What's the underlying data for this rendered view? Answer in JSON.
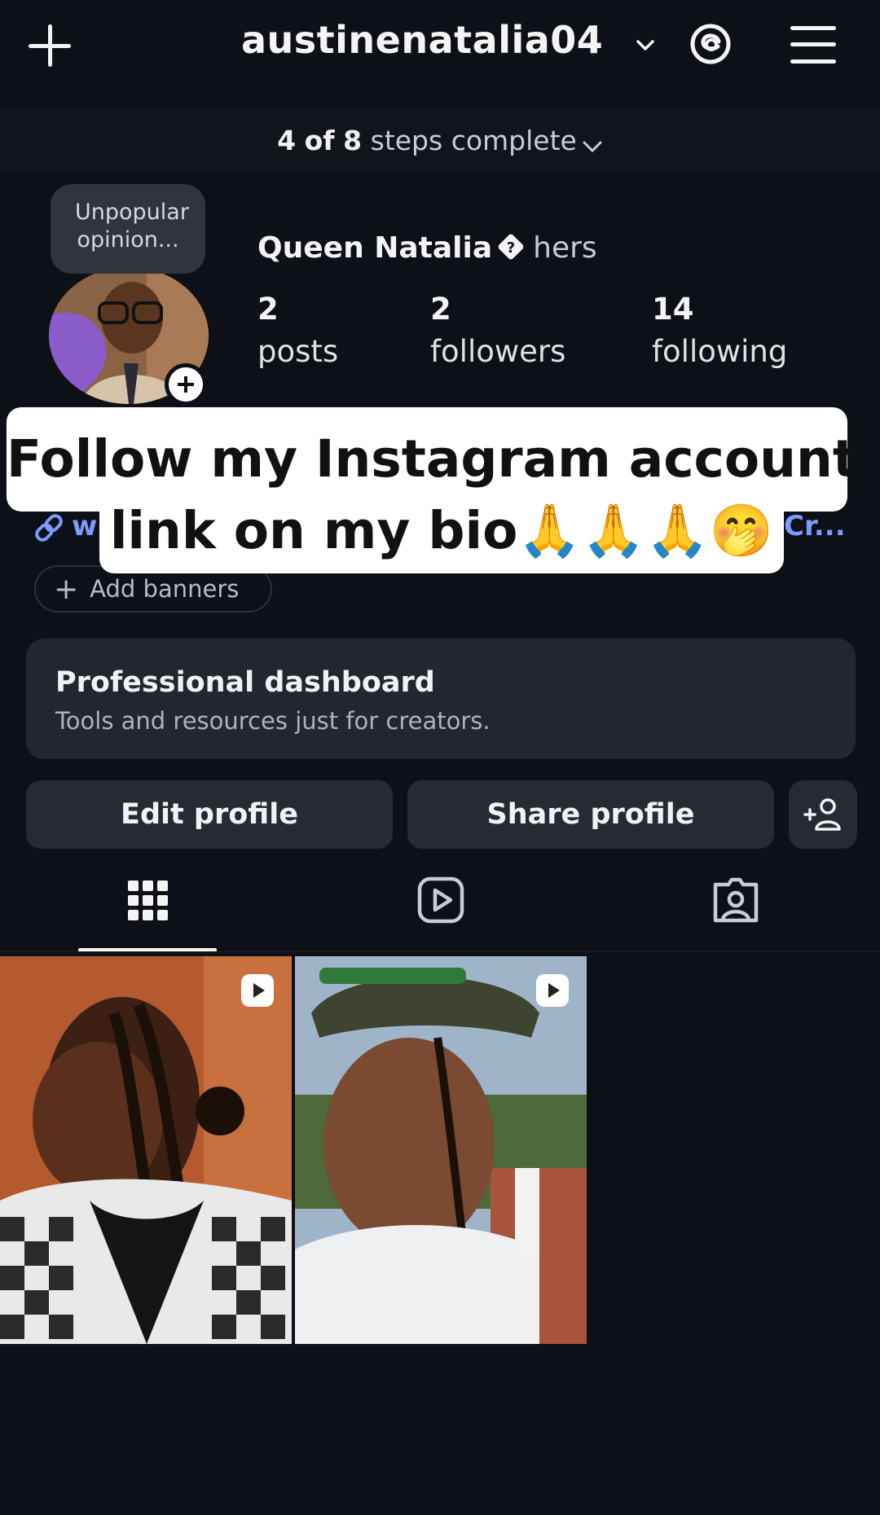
{
  "header": {
    "username": "austinenatalia04",
    "icons": [
      "plus-icon",
      "chevron-down-icon",
      "threads-icon",
      "menu-icon"
    ]
  },
  "steps": {
    "done": "4",
    "of": "of",
    "total": "8",
    "suffix": "steps complete"
  },
  "profile": {
    "note": "Unpopular opinion...",
    "display_name": "Queen Natalia",
    "pronouns": "hers",
    "stats": [
      {
        "value": "2",
        "label": "posts"
      },
      {
        "value": "2",
        "label": "followers"
      },
      {
        "value": "14",
        "label": "following"
      }
    ],
    "bio_link_partial_left": "w",
    "bio_link_partial_right": "Cr...",
    "add_banners_label": "Add banners"
  },
  "caption": {
    "line1": "Follow my Instagram account",
    "line2": "link on my bio🙏🙏🙏🤭"
  },
  "professional_dashboard": {
    "title": "Professional dashboard",
    "subtitle": "Tools and resources just for creators."
  },
  "buttons": {
    "edit_profile": "Edit profile",
    "share_profile": "Share profile"
  },
  "tabs": [
    "grid-icon",
    "reels-icon",
    "tagged-icon"
  ],
  "posts": [
    {
      "type": "reel",
      "icon": "reel-icon"
    },
    {
      "type": "reel",
      "icon": "reel-icon"
    }
  ],
  "colors": {
    "background": "#0d1016",
    "card": "#22262e",
    "link": "#7a9cff",
    "caption_bg": "#ffffff"
  }
}
